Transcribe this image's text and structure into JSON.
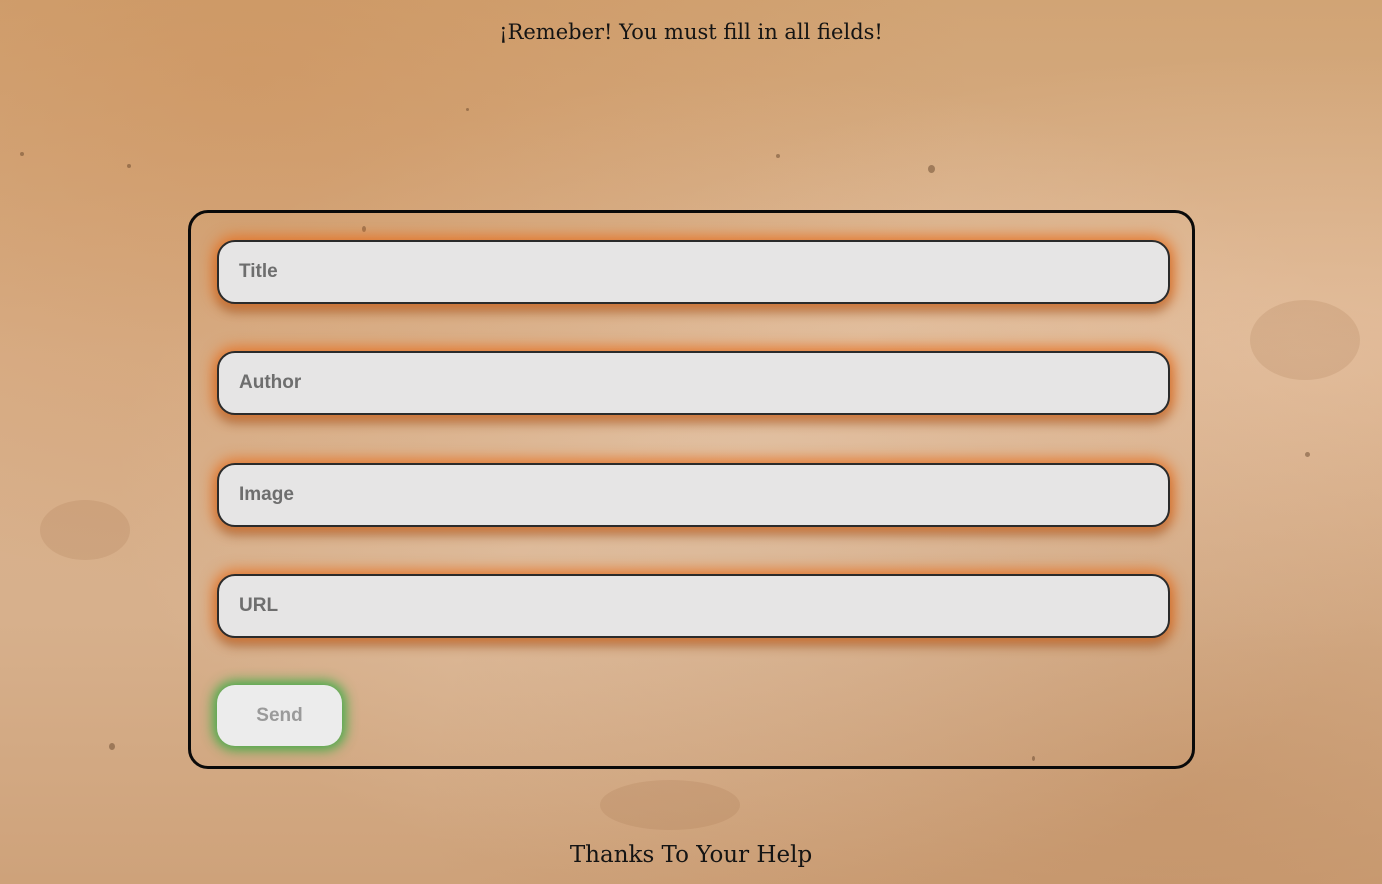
{
  "header": {
    "reminder": "¡Remeber! You must fill in all fields!"
  },
  "form": {
    "fields": [
      {
        "placeholder": "Title",
        "value": ""
      },
      {
        "placeholder": "Author",
        "value": ""
      },
      {
        "placeholder": "Image",
        "value": ""
      },
      {
        "placeholder": "URL",
        "value": ""
      }
    ],
    "send_label": "Send"
  },
  "footer": {
    "thanks": "Thanks To Your Help"
  },
  "colors": {
    "background": "#d6ab82",
    "field_glow": "#e66e1e",
    "send_glow": "#28aa3c",
    "field_fill": "#e6e5e5",
    "border": "#0a0a0a"
  }
}
